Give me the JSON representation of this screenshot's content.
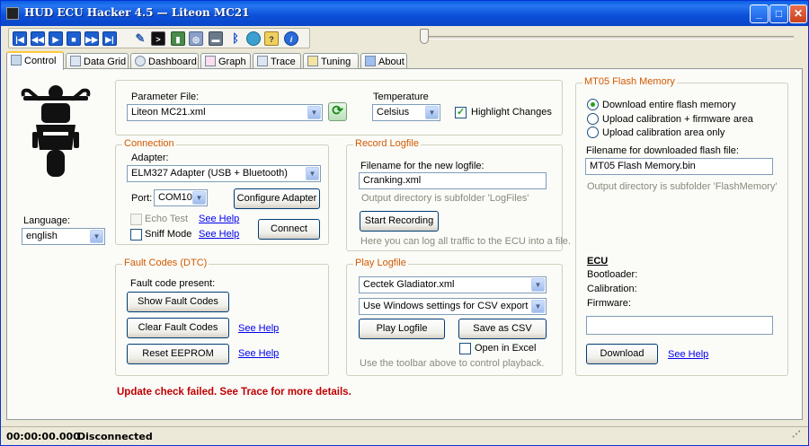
{
  "window": {
    "title": "HUD ECU Hacker 4.5 — Liteon MC21"
  },
  "toolbar": {
    "icons": [
      "first-icon",
      "prev-icon",
      "play-icon",
      "stop-icon",
      "next-icon",
      "last-icon",
      "wrench-icon",
      "terminal-icon",
      "data-icon",
      "database-icon",
      "adapter-icon",
      "bluetooth-icon",
      "globe-icon",
      "help-icon",
      "info-icon"
    ]
  },
  "tabs": [
    {
      "label": "Control",
      "icon": "control-icon"
    },
    {
      "label": "Data Grid",
      "icon": "grid-icon"
    },
    {
      "label": "Dashboard",
      "icon": "dashboard-icon"
    },
    {
      "label": "Graph",
      "icon": "graph-icon"
    },
    {
      "label": "Trace",
      "icon": "trace-icon"
    },
    {
      "label": "Tuning",
      "icon": "tuning-icon"
    },
    {
      "label": "About",
      "icon": "about-icon"
    }
  ],
  "left": {
    "language_label": "Language:",
    "language_value": "english"
  },
  "param": {
    "file_label": "Parameter File:",
    "file_value": "Liteon MC21.xml",
    "temp_label": "Temperature",
    "temp_value": "Celsius",
    "highlight_label": "Highlight Changes"
  },
  "connection": {
    "title": "Connection",
    "adapter_label": "Adapter:",
    "adapter_value": "ELM327 Adapter (USB + Bluetooth)",
    "port_label": "Port:",
    "port_value": "COM10",
    "configure_label": "Configure Adapter",
    "echo_label": "Echo Test",
    "sniff_label": "Sniff Mode",
    "see_help": "See Help",
    "connect_label": "Connect"
  },
  "record": {
    "title": "Record Logfile",
    "filename_label": "Filename for the new logfile:",
    "filename_value": "Cranking.xml",
    "outdir_hint": "Output directory is subfolder 'LogFiles'",
    "start_label": "Start Recording",
    "traffic_hint": "Here you can log all traffic to the ECU into a file."
  },
  "fault": {
    "title": "Fault Codes (DTC)",
    "present_label": "Fault code present:",
    "show_label": "Show Fault Codes",
    "clear_label": "Clear Fault Codes",
    "reset_label": "Reset EEPROM",
    "see_help": "See Help"
  },
  "play": {
    "title": "Play Logfile",
    "file_value": "Cectek Gladiator.xml",
    "csv_value": "Use Windows settings for CSV export",
    "play_label": "Play Logfile",
    "save_label": "Save as CSV",
    "excel_label": "Open in Excel",
    "hint": "Use the toolbar above to control playback."
  },
  "flash": {
    "title": "MT05 Flash Memory",
    "opt1": "Download entire flash memory",
    "opt2": "Upload calibration + firmware area",
    "opt3": "Upload calibration area only",
    "filename_label": "Filename for downloaded flash file:",
    "filename_value": "MT05 Flash Memory.bin",
    "outdir_hint": "Output directory is subfolder 'FlashMemory'"
  },
  "ecu": {
    "title": "ECU",
    "bootloader": "Bootloader:",
    "calibration": "Calibration:",
    "firmware": "Firmware:",
    "download_label": "Download",
    "see_help": "See Help"
  },
  "update_msg": "Update check failed. See Trace for more details.",
  "status": {
    "time": "00:00:00.000",
    "state": "Disconnected"
  },
  "colors": {
    "accent": "#d25a00",
    "link": "#0000ee",
    "error": "#c00000"
  }
}
